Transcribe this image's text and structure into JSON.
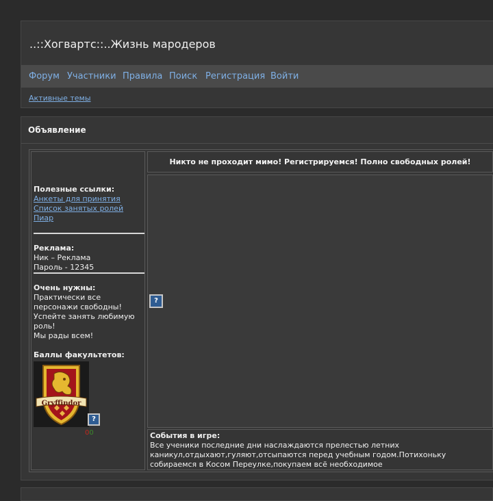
{
  "site": {
    "title": "..::Хогвартс::..Жизнь мародеров"
  },
  "nav": {
    "items": [
      "Форум",
      "Участники",
      "Правила",
      "Поиск",
      "Регистрация",
      "Войти"
    ],
    "active_topics": "Активные темы"
  },
  "announcement": {
    "title": "Объявление",
    "headline": "Никто не проходит мимо! Регистрируемся! Полно свободных ролей!",
    "events_label": "События в игре:",
    "events_text": "Все ученики последние дни наслаждаются прелестью летних каникул,отдыхают,гуляют,отсыпаются перед учебным годом.Потихоньку собираемся в Косом Переулке,покупаем всё необходимое"
  },
  "sidebar": {
    "links_label": "Полезные ссылки:",
    "links": [
      "Анкеты для принятия",
      "Список занятых ролей",
      "Пиар"
    ],
    "ad_label": "Реклама:",
    "ad_lines": [
      "Ник – Реклама",
      "Пароль - 12345"
    ],
    "needed_label": "Очень нужны:",
    "needed_lines": [
      "Практически все персонажи свободны!",
      "Успейте занять любимую роль!",
      "Мы рады всем!"
    ],
    "points_label": "Баллы факультетов:",
    "crest_text": "Gryffindor",
    "score": "00"
  },
  "placeholder_image": {
    "glyph": "?"
  },
  "colors": {
    "background": "#2b2b2b",
    "panel": "#363636",
    "navbar": "#4a4a4a",
    "link": "#7fb0e6",
    "gryffindor_red": "#a3141b",
    "gryffindor_gold": "#e5b730"
  }
}
